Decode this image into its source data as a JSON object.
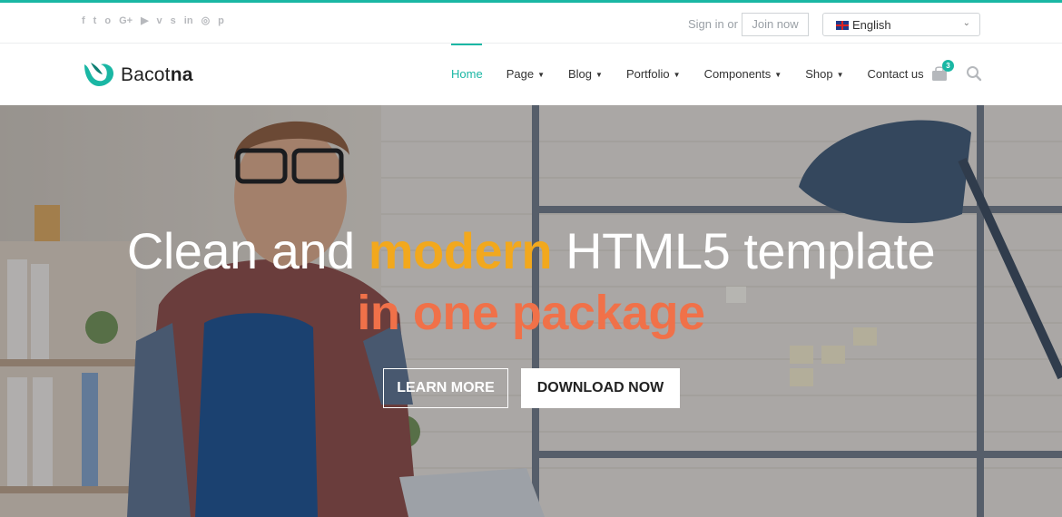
{
  "topbar": {
    "social_icons": [
      "facebook-icon",
      "twitter-icon",
      "instagram-icon",
      "google-plus-icon",
      "youtube-icon",
      "vimeo-icon",
      "skype-icon",
      "linkedin-icon",
      "dribbble-icon",
      "pinterest-icon"
    ],
    "social_glyphs": [
      "f",
      "t",
      "o",
      "G+",
      "▶",
      "v",
      "s",
      "in",
      "◎",
      "p"
    ],
    "sign_in_text": "Sign in or",
    "join_label": "Join now",
    "language": {
      "selected": "English",
      "flag": "uk-flag-icon",
      "chevron": "⌄"
    }
  },
  "brand": {
    "name_light": "Bacot",
    "name_bold": "na",
    "accent_color": "#1ab7a4"
  },
  "nav": {
    "items": [
      {
        "label": "Home",
        "dropdown": false,
        "active": true
      },
      {
        "label": "Page",
        "dropdown": true,
        "active": false
      },
      {
        "label": "Blog",
        "dropdown": true,
        "active": false
      },
      {
        "label": "Portfolio",
        "dropdown": true,
        "active": false
      },
      {
        "label": "Components",
        "dropdown": true,
        "active": false
      },
      {
        "label": "Shop",
        "dropdown": true,
        "active": false
      },
      {
        "label": "Contact us",
        "dropdown": false,
        "active": false
      }
    ],
    "caret": "▼",
    "cart_count": "3"
  },
  "hero": {
    "line1_before": "Clean and ",
    "line1_accent": "modern",
    "line1_after": " HTML5 template",
    "line2": "in one package",
    "accent_color": "#f2a81d",
    "line2_color": "#f07149",
    "learn_more_label": "LEARN MORE",
    "download_label": "DOWNLOAD NOW"
  }
}
